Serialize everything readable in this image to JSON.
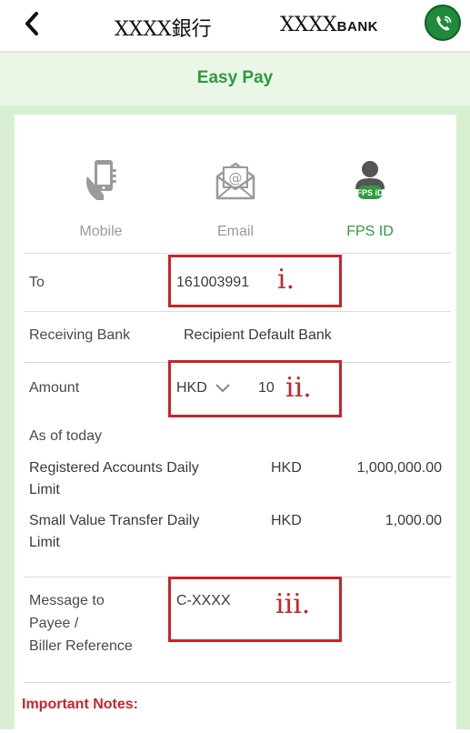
{
  "topbar": {
    "back_icon": "chevron-left-icon",
    "bank_name_cn": "XXXX銀行",
    "bank_name_en_prefix": "XXXX",
    "bank_name_en_suffix": "BANK",
    "call_icon": "phone-icon",
    "accent": "#1f8a3a"
  },
  "header": {
    "title": "Easy Pay",
    "color": "#2e9a3e",
    "background": "#eaf7e6"
  },
  "methods": [
    {
      "label": "Mobile",
      "icon": "mobile-phone-icon",
      "active": false
    },
    {
      "label": "Email",
      "icon": "email-icon",
      "active": false
    },
    {
      "label": "FPS ID",
      "icon": "fps-id-icon",
      "badge": "FPS iD",
      "active": true
    }
  ],
  "form": {
    "to_label": "To",
    "to_value": "161003991",
    "to_annotation": "i.",
    "receiving_bank_label": "Receiving Bank",
    "receiving_bank_value": "Recipient Default Bank",
    "amount_label": "Amount",
    "currency": "HKD",
    "amount_value": "10",
    "amount_annotation": "ii.",
    "as_of_today": "As of today",
    "limits": [
      {
        "label_line1": "Registered Accounts Daily",
        "label_line2": "Limit",
        "currency": "HKD",
        "amount": "1,000,000.00"
      },
      {
        "label_line1": "Small Value Transfer Daily",
        "label_line2": "Limit",
        "currency": "HKD",
        "amount": "1,000.00"
      }
    ],
    "message_label_line1": "Message to",
    "message_label_line2": "Payee /",
    "message_label_line3": "Biller Reference",
    "message_value": "C-XXXX",
    "message_annotation": "iii."
  },
  "notes": {
    "title": "Important Notes:",
    "color": "#c8242b"
  }
}
